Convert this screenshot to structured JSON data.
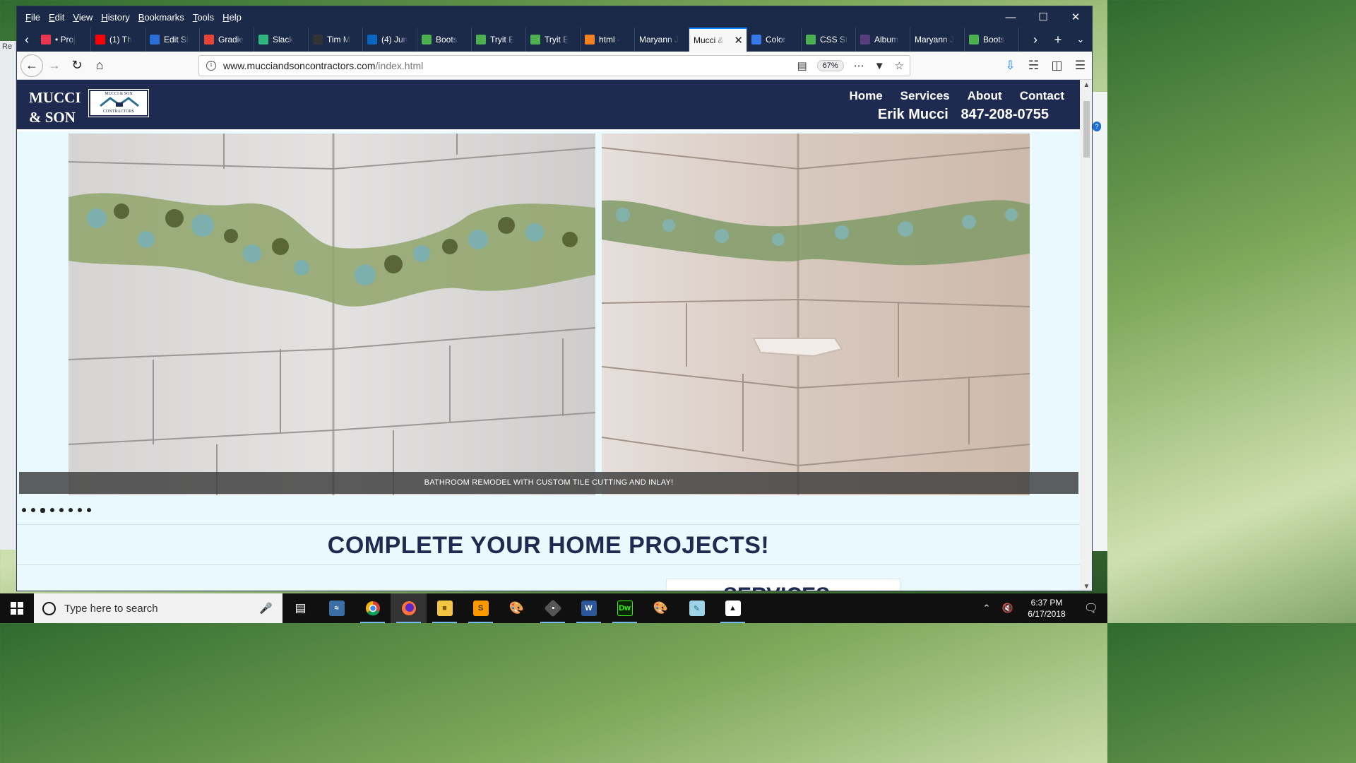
{
  "browser": {
    "menu": [
      "File",
      "Edit",
      "View",
      "History",
      "Bookmarks",
      "Tools",
      "Help"
    ],
    "tabs": [
      {
        "label": "• Proj",
        "icon": "asana-icon",
        "color": "#e8384f"
      },
      {
        "label": "(1) Th",
        "icon": "youtube-icon",
        "color": "#ff0000"
      },
      {
        "label": "Edit Sl",
        "icon": "edit-icon",
        "color": "#2b6fd6"
      },
      {
        "label": "Gradie",
        "icon": "square-red-icon",
        "color": "#e94235"
      },
      {
        "label": "Slack",
        "icon": "phone-green-icon",
        "color": "#2eb67d"
      },
      {
        "label": "Tim M",
        "icon": "github-icon",
        "color": "#ffffff"
      },
      {
        "label": "(4) Jun",
        "icon": "linkedin-icon",
        "color": "#0a66c2"
      },
      {
        "label": "Boots",
        "icon": "w3-icon",
        "color": "#4caf50"
      },
      {
        "label": "Tryit E",
        "icon": "w3-icon",
        "color": "#4caf50"
      },
      {
        "label": "Tryit E",
        "icon": "w3-icon",
        "color": "#4caf50"
      },
      {
        "label": "html -",
        "icon": "stackoverflow-icon",
        "color": "#f48024"
      },
      {
        "label": "Maryann J",
        "icon": "",
        "color": ""
      },
      {
        "label": "Mucci &",
        "icon": "",
        "color": "",
        "active": true
      },
      {
        "label": "Color",
        "icon": "color-icon",
        "color": "#3b78e7"
      },
      {
        "label": "CSS St",
        "icon": "w3-icon",
        "color": "#4caf50"
      },
      {
        "label": "Album",
        "icon": "bootstrap-icon",
        "color": "#563d7c"
      },
      {
        "label": "Maryann J",
        "icon": "",
        "color": ""
      },
      {
        "label": "Boots",
        "icon": "w3-icon",
        "color": "#4caf50"
      }
    ],
    "url_host": "www.mucciandsoncontractors.com",
    "url_path": "/index.html",
    "zoom": "67%"
  },
  "site": {
    "logo_line1": "MUCCI",
    "logo_line2": "& SON",
    "badge_line1": "MUCCI & SON",
    "badge_line2": "CONTRACTORS",
    "nav": [
      "Home",
      "Services",
      "About",
      "Contact"
    ],
    "contact_name": "Erik Mucci",
    "contact_phone": "847-208-0755",
    "caption": "BATHROOM REMODEL WITH CUSTOM TILE CUTTING AND INLAY!",
    "dots_count": 8,
    "active_dot": 2,
    "headline": "COMPLETE YOUR HOME PROJECTS!",
    "services_heading": "SERVICES",
    "brand_color": "#1e2a4f"
  },
  "taskbar": {
    "search_placeholder": "Type here to search",
    "time": "6:37 PM",
    "date": "6/17/2018"
  }
}
